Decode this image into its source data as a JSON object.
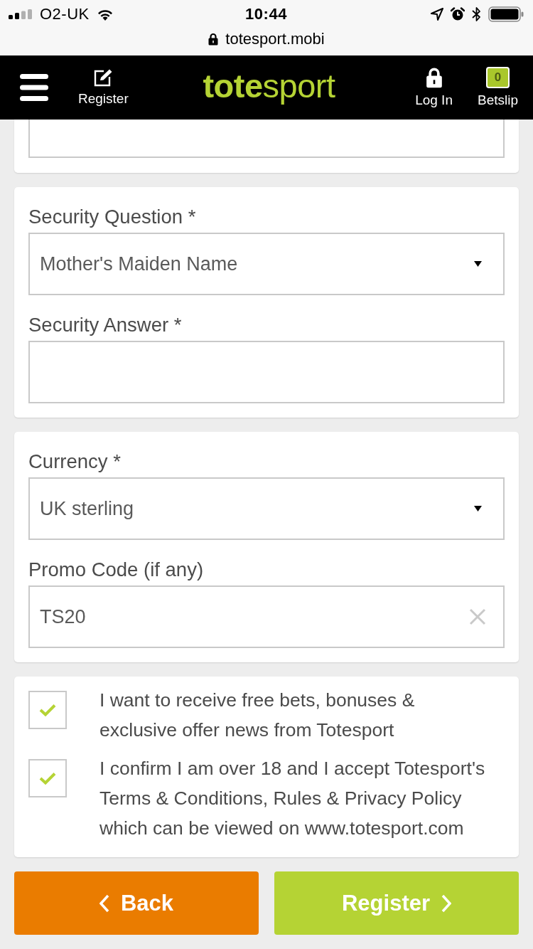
{
  "status_bar": {
    "carrier": "O2-UK",
    "time": "10:44"
  },
  "address_bar": {
    "url": "totesport.mobi"
  },
  "header": {
    "register_label": "Register",
    "logo": "**tote**sport",
    "login_label": "Log In",
    "betslip_label": "Betslip",
    "betslip_count": "0"
  },
  "cards": [
    {
      "fields": [
        {
          "kind": "input",
          "clipped": true
        }
      ]
    },
    {
      "fields": [
        {
          "kind": "select",
          "label": "Security Question *",
          "value": "Mother's Maiden Name"
        },
        {
          "kind": "input",
          "label": "Security Answer *"
        }
      ]
    },
    {
      "fields": [
        {
          "kind": "select",
          "label": "Currency *",
          "value": "UK sterling"
        },
        {
          "kind": "input",
          "label": "Promo Code (if any)",
          "value": "TS20",
          "clearable": true
        }
      ]
    }
  ],
  "consents": [
    {
      "checked": true,
      "lines": [
        "I want to receive free bets, bonuses &",
        "exclusive offer news from Totesport"
      ]
    },
    {
      "checked": true,
      "lines": [
        "I confirm I am over 18 and I accept Totesport's",
        "Terms & Conditions, Rules & Privacy Policy",
        "which can be viewed on www.totesport.com"
      ]
    }
  ],
  "buttons": [
    {
      "kind": "back",
      "label": "Back"
    },
    {
      "kind": "next",
      "label": "Register"
    }
  ]
}
